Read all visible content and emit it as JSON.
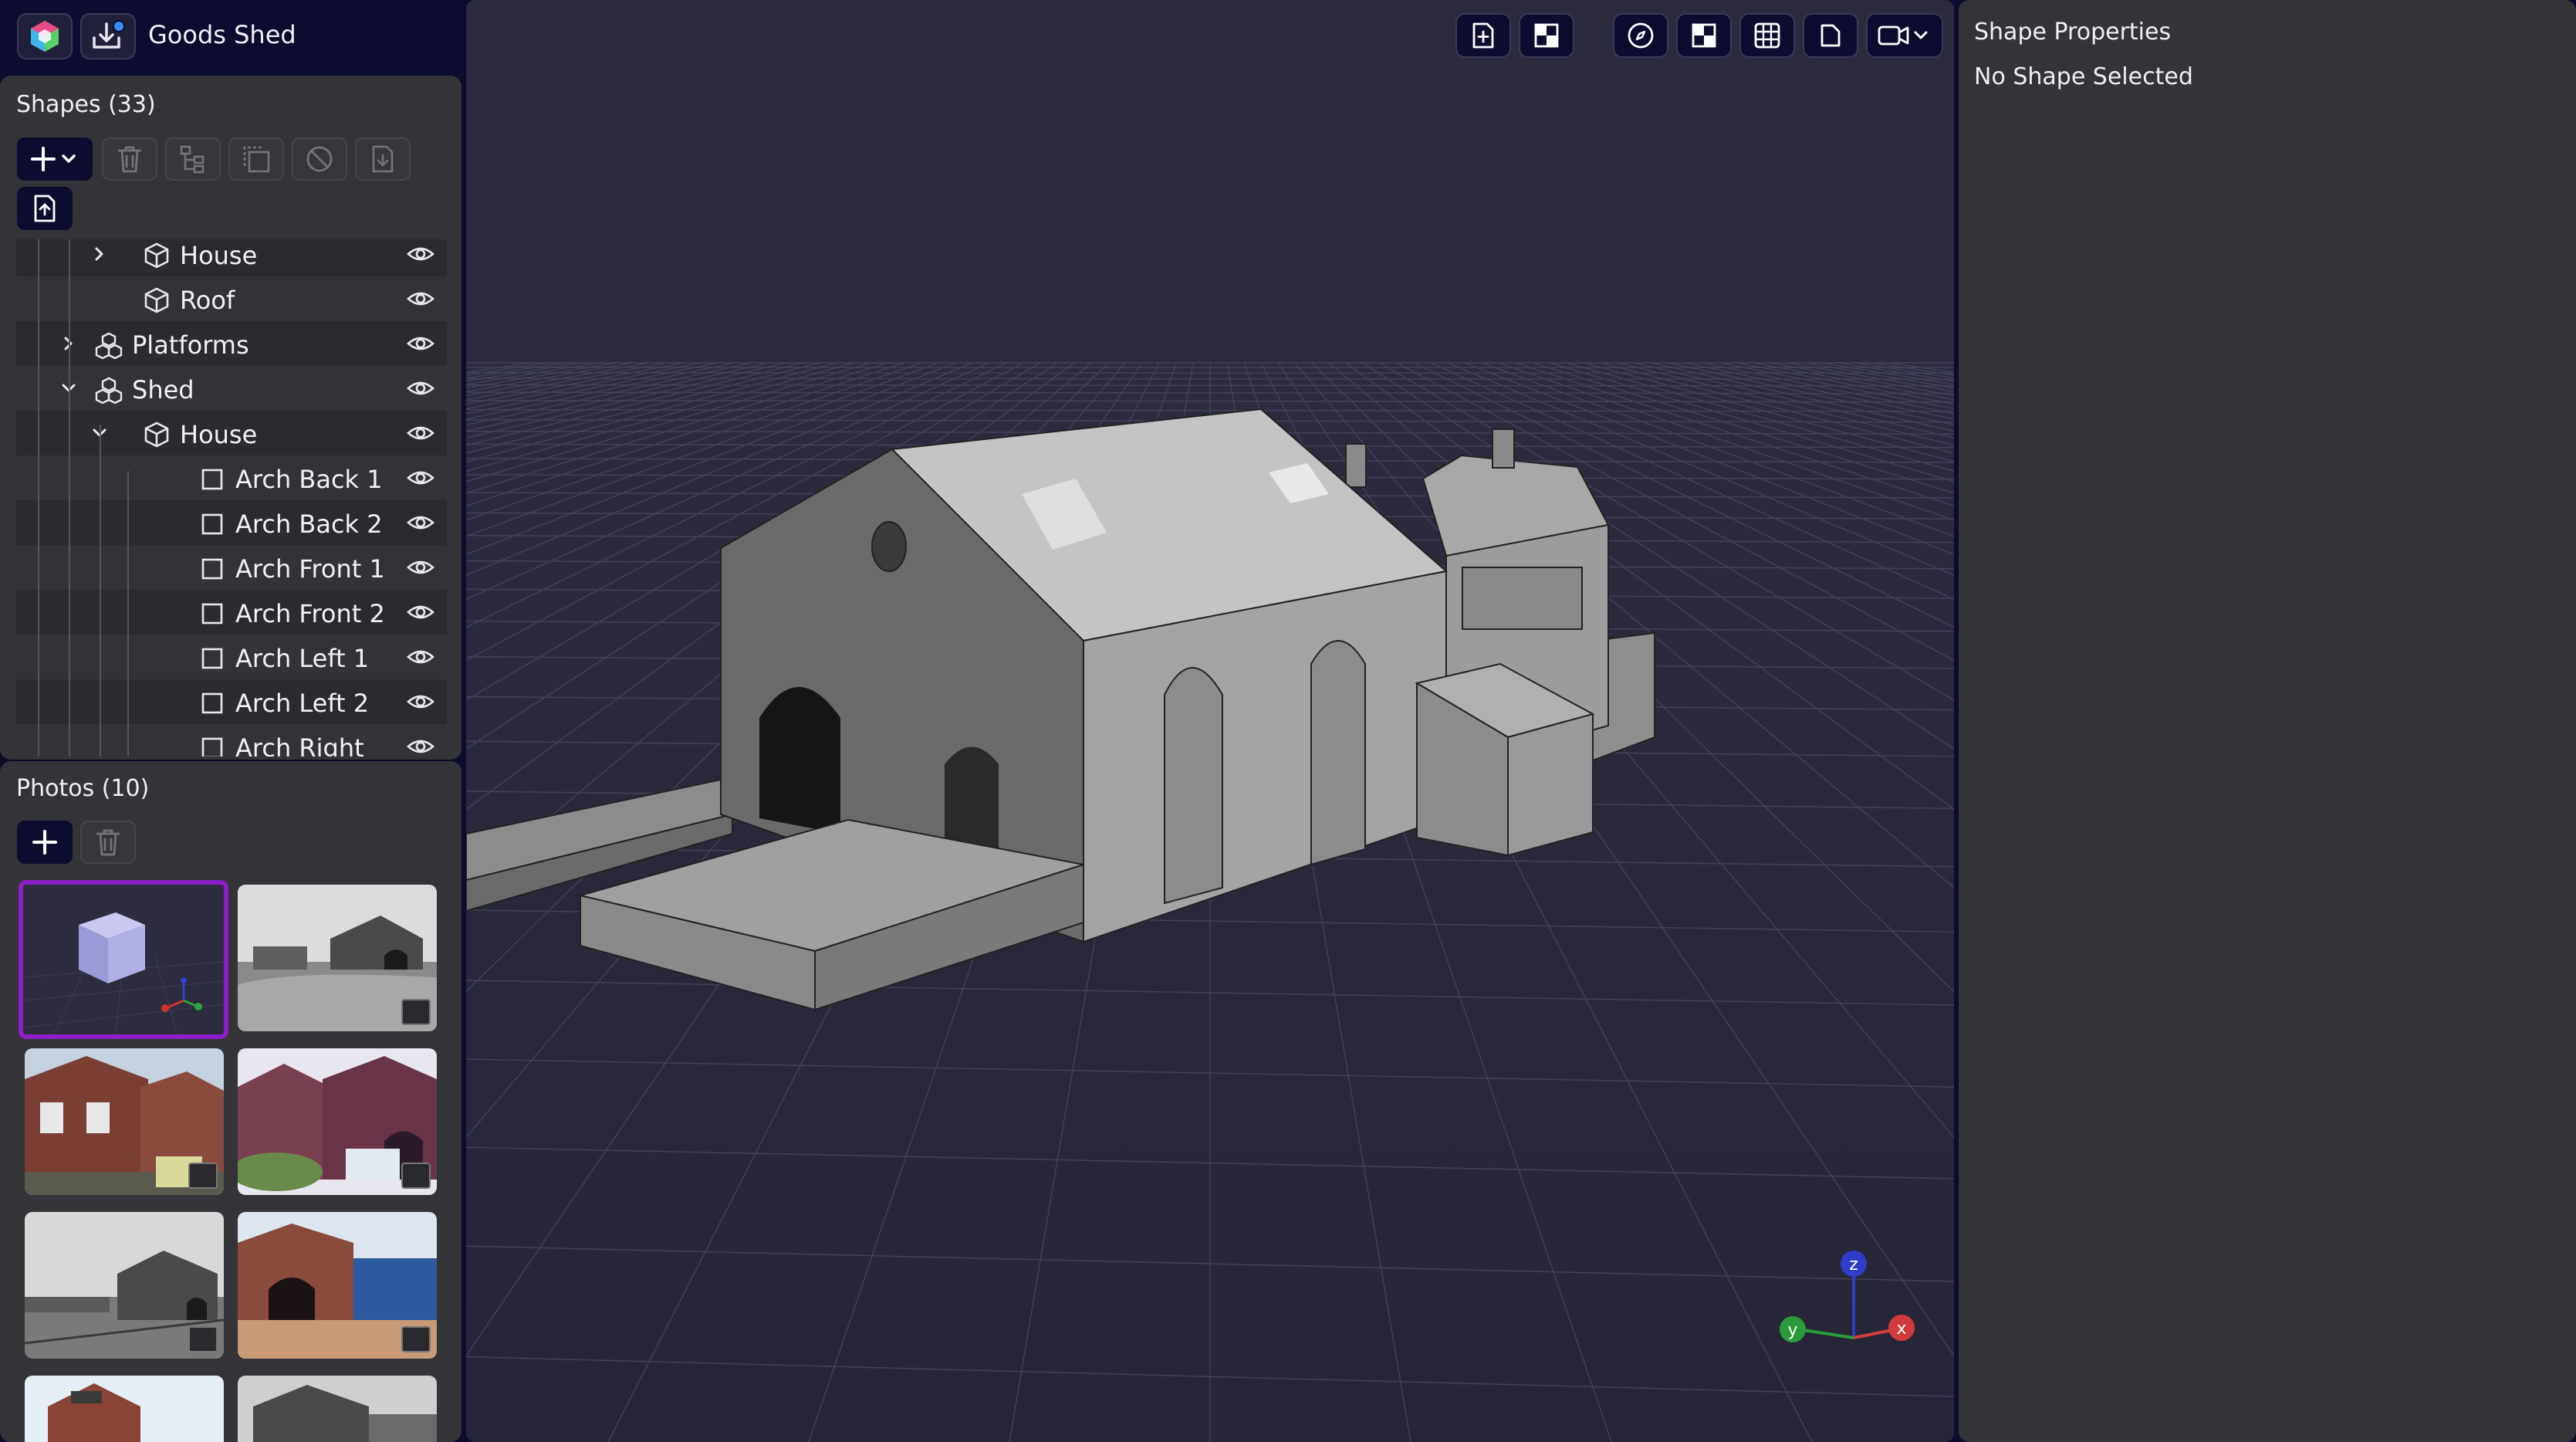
{
  "app": {
    "document_title": "Goods Shed"
  },
  "shapes_panel": {
    "title": "Shapes (33)",
    "tree": [
      {
        "label": "House",
        "icon": "cube-icon",
        "level": 2,
        "expander": "chevron-right"
      },
      {
        "label": "Roof",
        "icon": "cube-icon",
        "level": 2,
        "expander": "none"
      },
      {
        "label": "Platforms",
        "icon": "group-icon",
        "level": 1,
        "expander": "chevron-right"
      },
      {
        "label": "Shed",
        "icon": "group-icon",
        "level": 1,
        "expander": "chevron-down"
      },
      {
        "label": "House",
        "icon": "cube-icon",
        "level": 2,
        "expander": "chevron-down"
      },
      {
        "label": "Arch Back 1",
        "icon": "square-icon",
        "level": 3,
        "expander": "none"
      },
      {
        "label": "Arch Back 2",
        "icon": "square-icon",
        "level": 3,
        "expander": "none"
      },
      {
        "label": "Arch Front 1",
        "icon": "square-icon",
        "level": 3,
        "expander": "none"
      },
      {
        "label": "Arch Front 2",
        "icon": "square-icon",
        "level": 3,
        "expander": "none"
      },
      {
        "label": "Arch Left 1",
        "icon": "square-icon",
        "level": 3,
        "expander": "none"
      },
      {
        "label": "Arch Left 2",
        "icon": "square-icon",
        "level": 3,
        "expander": "none"
      },
      {
        "label": "Arch Right",
        "icon": "square-icon",
        "level": 3,
        "expander": "none"
      }
    ]
  },
  "photos_panel": {
    "title": "Photos (10)",
    "selected_index": 0
  },
  "properties_panel": {
    "title": "Shape Properties",
    "status": "No Shape Selected"
  },
  "axes_gizmo": {
    "x": "x",
    "y": "y",
    "z": "z"
  },
  "colors": {
    "accent_selection": "#8a1fc8",
    "app_background": "#0c0c2c",
    "panel": "#333338",
    "axis_x": "#d23b3b",
    "axis_y": "#2a9a3a",
    "axis_z": "#2f3cc8"
  }
}
